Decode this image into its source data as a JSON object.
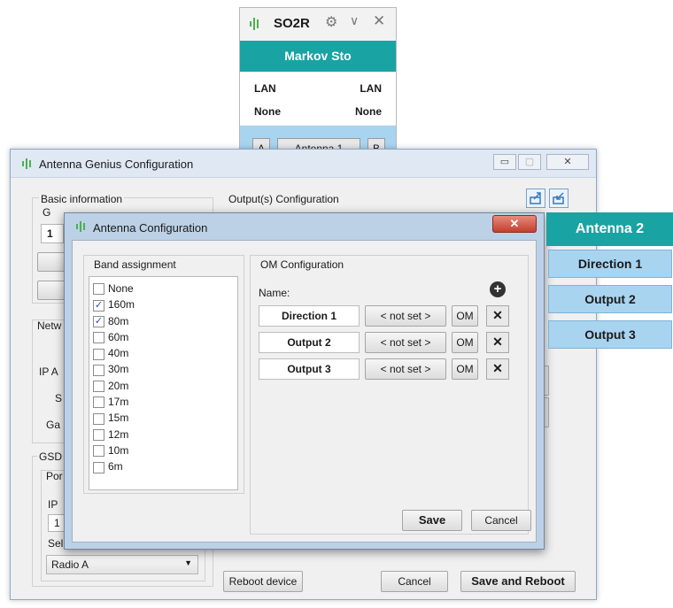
{
  "mini_panel": {
    "title": "SO2R",
    "operator": "Markov Sto",
    "left_label": "LAN",
    "right_label": "LAN",
    "left_value": "None",
    "right_value": "None",
    "a_button": "A",
    "antenna_button": "Antenna 1",
    "b_button": "B",
    "colors": {
      "teal": "#1aa3a3",
      "blue": "#a8d4f0",
      "logo_green": "#4caf50"
    }
  },
  "main_window": {
    "title": "Antenna Genius Configuration",
    "basic_info_title": "Basic information",
    "basic_fragment_g": "G",
    "basic_value": "1",
    "network_fragment": "Netw",
    "ip_fragment": "IP A",
    "s_fragment": "S",
    "ga_fragment": "Ga",
    "gsd_fragment": "GSD",
    "port_fragment": "Por",
    "ip2_fragment": "IP",
    "ip2_value": "1",
    "sel_fragment": "Sel",
    "radio_select": "Radio A",
    "outputs_title": "Output(s) Configuration",
    "reboot_button": "Reboot device",
    "cancel_button": "Cancel",
    "save_reboot_button": "Save and Reboot"
  },
  "dialog": {
    "title": "Antenna Configuration",
    "band_title": "Band assignment",
    "bands": [
      {
        "label": "None",
        "checked": false
      },
      {
        "label": "160m",
        "checked": true
      },
      {
        "label": "80m",
        "checked": true
      },
      {
        "label": "60m",
        "checked": false
      },
      {
        "label": "40m",
        "checked": false
      },
      {
        "label": "30m",
        "checked": false
      },
      {
        "label": "20m",
        "checked": false
      },
      {
        "label": "17m",
        "checked": false
      },
      {
        "label": "15m",
        "checked": false
      },
      {
        "label": "12m",
        "checked": false
      },
      {
        "label": "10m",
        "checked": false
      },
      {
        "label": "6m",
        "checked": false
      }
    ],
    "om_title": "OM Configuration",
    "name_label": "Name:",
    "rows": [
      {
        "name": "Direction 1",
        "notset": "< not set >",
        "om": "OM"
      },
      {
        "name": "Output 2",
        "notset": "< not set >",
        "om": "OM"
      },
      {
        "name": "Output 3",
        "notset": "< not set >",
        "om": "OM"
      }
    ],
    "save_button": "Save",
    "cancel_button": "Cancel"
  },
  "side_panel": {
    "header": "Antenna 2",
    "items": [
      "Direction 1",
      "Output 2",
      "Output 3"
    ]
  }
}
